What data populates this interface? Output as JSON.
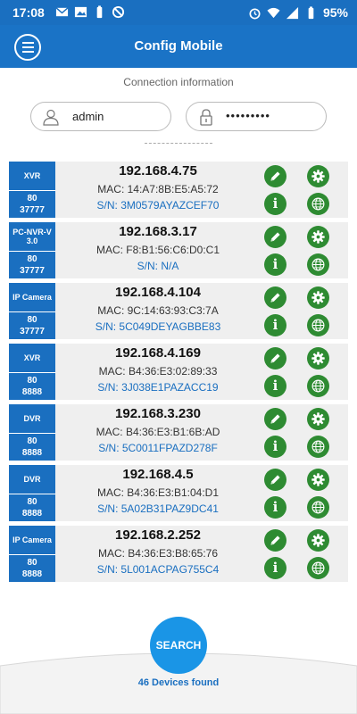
{
  "status_bar": {
    "time": "17:08",
    "battery": "95%",
    "left_icons": [
      "mail-icon",
      "image-icon",
      "battery-saver-icon",
      "sync-disabled-icon"
    ],
    "right_icons": [
      "alarm-icon",
      "wifi-icon",
      "signal-icon",
      "battery-icon"
    ]
  },
  "app_bar": {
    "title": "Config Mobile",
    "menu_icon": "hamburger-menu-icon"
  },
  "connection": {
    "label": "Connection information",
    "username": "admin",
    "password": "•••••••••",
    "divider": "-------------------"
  },
  "devices": [
    {
      "type": "XVR",
      "port1": "80",
      "port2": "37777",
      "ip": "192.168.4.75",
      "mac": "MAC: 14:A7:8B:E5:A5:72",
      "sn": "S/N: 3M0579AYAZCEF70"
    },
    {
      "type": "PC-NVR-V 3.0",
      "port1": "80",
      "port2": "37777",
      "ip": "192.168.3.17",
      "mac": "MAC: F8:B1:56:C6:D0:C1",
      "sn": "S/N: N/A"
    },
    {
      "type": "IP Camera",
      "port1": "80",
      "port2": "37777",
      "ip": "192.168.4.104",
      "mac": "MAC: 9C:14:63:93:C3:7A",
      "sn": "S/N: 5C049DEYAGBBE83"
    },
    {
      "type": "XVR",
      "port1": "80",
      "port2": "8888",
      "ip": "192.168.4.169",
      "mac": "MAC: B4:36:E3:02:89:33",
      "sn": "S/N: 3J038E1PAZACC19"
    },
    {
      "type": "DVR",
      "port1": "80",
      "port2": "8888",
      "ip": "192.168.3.230",
      "mac": "MAC: B4:36:E3:B1:6B:AD",
      "sn": "S/N: 5C0011FPAZD278F"
    },
    {
      "type": "DVR",
      "port1": "80",
      "port2": "8888",
      "ip": "192.168.4.5",
      "mac": "MAC: B4:36:E3:B1:04:D1",
      "sn": "S/N: 5A02B31PAZ9DC41"
    },
    {
      "type": "IP Camera",
      "port1": "80",
      "port2": "8888",
      "ip": "192.168.2.252",
      "mac": "MAC: B4:36:E3:B8:65:76",
      "sn": "S/N: 5L001ACPAG755C4"
    }
  ],
  "row_actions": [
    "edit-pencil-icon",
    "settings-gear-icon",
    "info-icon",
    "web-globe-icon"
  ],
  "info_glyph": "i",
  "search_button": "SEARCH",
  "devices_found": "46 Devices found",
  "colors": {
    "primary": "#1a73c6",
    "action_green": "#2e8b32",
    "sn_text": "#1a6fc0",
    "search_button": "#1a95e6"
  }
}
